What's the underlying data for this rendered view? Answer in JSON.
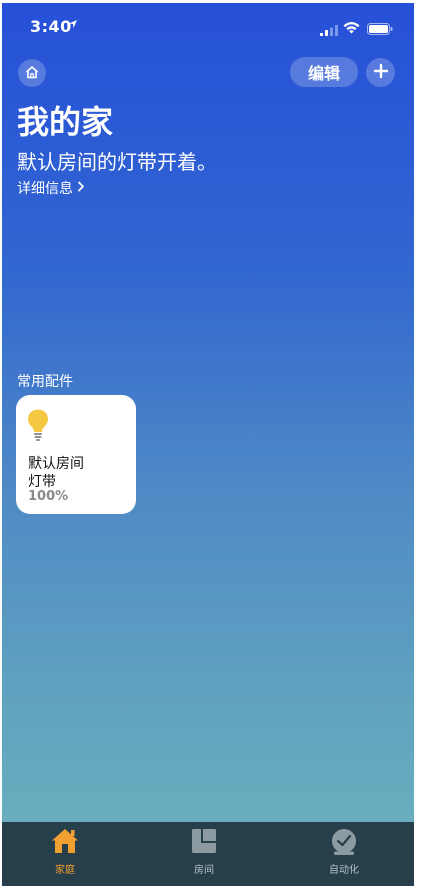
{
  "status_bar": {
    "time": "3:40",
    "location_glyph": "➤"
  },
  "header": {
    "edit_label": "编辑"
  },
  "home": {
    "title": "我的家",
    "summary": "默认房间的灯带开着。",
    "details_label": "详细信息"
  },
  "favorites": {
    "section_title": "常用配件",
    "accessory": {
      "room": "默认房间",
      "name": "灯带",
      "status": "100%"
    }
  },
  "tabs": [
    {
      "label": "家庭",
      "icon": "home-icon"
    },
    {
      "label": "房间",
      "icon": "rooms-icon"
    },
    {
      "label": "自动化",
      "icon": "automation-clock-icon"
    }
  ],
  "colors": {
    "gradient_top": "#2650d8",
    "gradient_bottom": "#6db3bd",
    "tabbar": "#273f4b",
    "active_tab": "#f0a030",
    "bulb": "#f5c842"
  }
}
